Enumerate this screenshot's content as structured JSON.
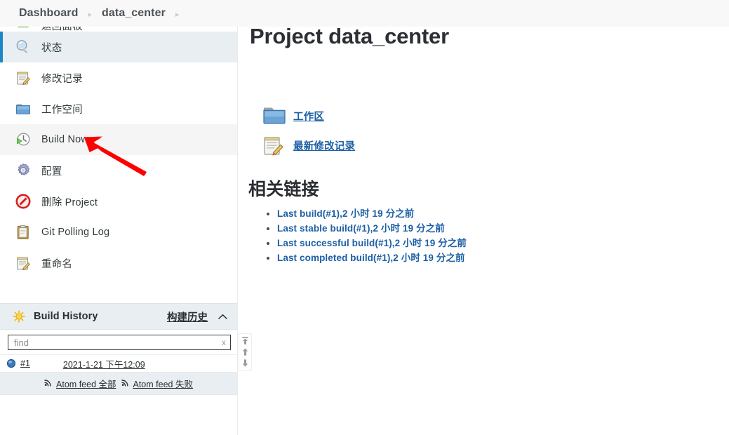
{
  "breadcrumb": {
    "items": [
      {
        "label": "Dashboard",
        "name": "breadcrumb-dashboard"
      },
      {
        "label": "data_center",
        "name": "breadcrumb-data-center"
      }
    ],
    "separator": "▸"
  },
  "sidebar": {
    "tasks": [
      {
        "label": "返回面板",
        "icon": "back-icon",
        "state": "clipped"
      },
      {
        "label": "状态",
        "icon": "magnifier-icon",
        "state": "active"
      },
      {
        "label": "修改记录",
        "icon": "changes-icon",
        "state": "normal"
      },
      {
        "label": "工作空间",
        "icon": "folder-icon",
        "state": "normal"
      },
      {
        "label": "Build Now",
        "icon": "clock-play-icon",
        "state": "hovered"
      },
      {
        "label": "配置",
        "icon": "gear-icon",
        "state": "normal"
      },
      {
        "label": "删除 Project",
        "icon": "delete-icon",
        "state": "normal"
      },
      {
        "label": "Git Polling Log",
        "icon": "clipboard-icon",
        "state": "normal"
      },
      {
        "label": "重命名",
        "icon": "rename-icon",
        "state": "normal"
      }
    ]
  },
  "build_history": {
    "sun_icon": "sun-icon",
    "title": "Build History",
    "link_label": "构建历史",
    "collapse_icon": "chevron-up-icon",
    "find_placeholder": "find",
    "find_value": "",
    "clear_label": "x",
    "builds": [
      {
        "ball": "blue-ball-icon",
        "number": "#1",
        "time": "2021-1-21 下午12:09"
      }
    ],
    "feeds": [
      {
        "icon": "rss-icon",
        "label": "Atom feed 全部"
      },
      {
        "icon": "rss-icon",
        "label": "Atom feed 失败"
      }
    ],
    "scroll_buttons": [
      {
        "name": "scroll-to-top-button",
        "icon": "arrow-to-top-icon"
      },
      {
        "name": "scroll-up-button",
        "icon": "arrow-up-icon"
      },
      {
        "name": "scroll-down-button",
        "icon": "arrow-down-icon"
      }
    ]
  },
  "main": {
    "title": "Project data_center",
    "project_links": [
      {
        "label": "工作区",
        "icon": "folder-icon"
      },
      {
        "label": "最新修改记录",
        "icon": "changes-icon"
      }
    ],
    "related": {
      "heading": "相关链接",
      "links": [
        "Last build(#1),2 小时 19 分之前",
        "Last stable build(#1),2 小时 19 分之前",
        "Last successful build(#1),2 小时 19 分之前",
        "Last completed build(#1),2 小时 19 分之前"
      ]
    }
  },
  "annotation": {
    "arrow_color": "#fe0000"
  },
  "colors": {
    "accent_blue": "#1b86c8",
    "link_blue": "#1c5fa5",
    "panel_bg": "#e8eef1",
    "breadcrumb_bg": "#f8f8f8"
  }
}
